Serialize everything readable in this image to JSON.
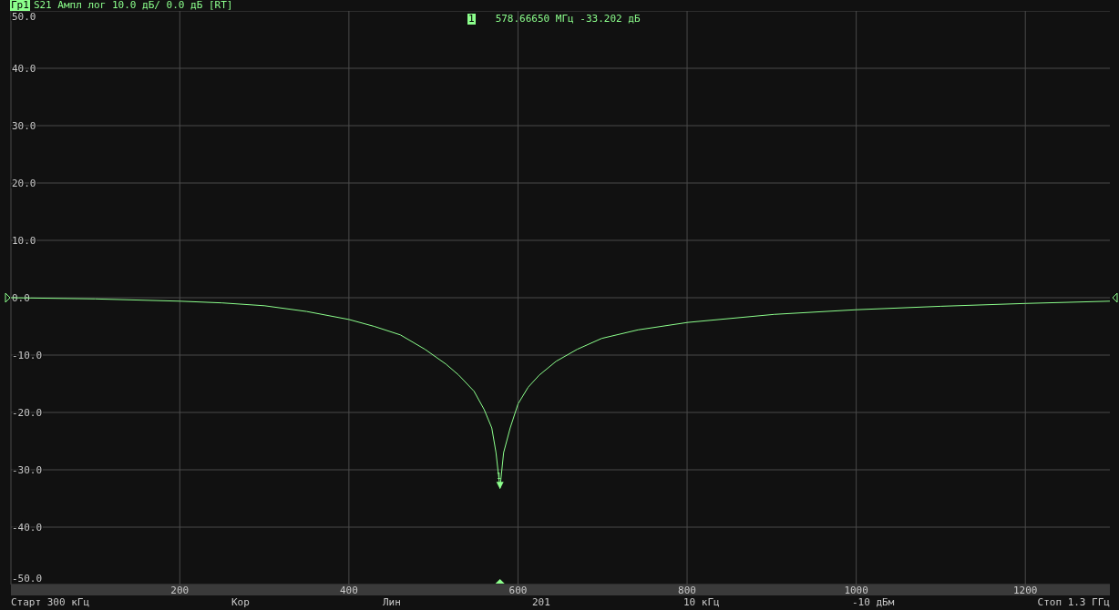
{
  "header": {
    "trace_id": "Гр1",
    "trace_format": "S21 Ампл лог 10.0 дБ/ 0.0 дБ [RT]"
  },
  "marker_readout": {
    "marker": "1",
    "text": "578.66650 МГц -33.202 дБ"
  },
  "chart_data": {
    "type": "line",
    "x": [
      0.3,
      100,
      200,
      250,
      300,
      350,
      400,
      430,
      461,
      490,
      515,
      530,
      548,
      560,
      569,
      574,
      578.7,
      583,
      590.8,
      600,
      612,
      625,
      645,
      670,
      699,
      742,
      801,
      903,
      1000,
      1100,
      1200,
      1300
    ],
    "series": [
      {
        "color": "#8cff8c",
        "values": [
          0,
          -0.2,
          -0.6,
          -0.9,
          -1.4,
          -2.4,
          -3.8,
          -5,
          -6.5,
          -9,
          -11.6,
          -13.5,
          -16.3,
          -19.5,
          -22.7,
          -27,
          -33.2,
          -27,
          -22.7,
          -18.5,
          -15.6,
          -13.5,
          -11.1,
          -9,
          -7.1,
          -5.6,
          -4.3,
          -2.9,
          -2.1,
          -1.5,
          -1.0,
          -0.6
        ]
      }
    ],
    "grid": true,
    "xlim": [
      0.3,
      1300
    ],
    "ylim": [
      -50,
      50
    ],
    "xticks": [
      200,
      400,
      600,
      800,
      1000,
      1200
    ],
    "yticks": [
      {
        "value": 50,
        "label": "50.0"
      },
      {
        "value": 40,
        "label": "40.0"
      },
      {
        "value": 30,
        "label": "30.0"
      },
      {
        "value": 20,
        "label": "20.0"
      },
      {
        "value": 10,
        "label": "10.0"
      },
      {
        "value": 0,
        "label": "0.0"
      },
      {
        "value": -10,
        "label": "-10.0"
      },
      {
        "value": -20,
        "label": "-20.0"
      },
      {
        "value": -30,
        "label": "-30.0"
      },
      {
        "value": -40,
        "label": "-40.0"
      },
      {
        "value": -50,
        "label": "-50.0"
      }
    ],
    "annotations": [
      {
        "x": 578.7,
        "y": -33.2,
        "text": "1"
      }
    ]
  },
  "status_bar": [
    "Старт 300 кГц",
    "Кор",
    "Лин",
    "201",
    "10 кГц",
    "-10 дБм",
    "Стоп 1.3 ГГц"
  ]
}
